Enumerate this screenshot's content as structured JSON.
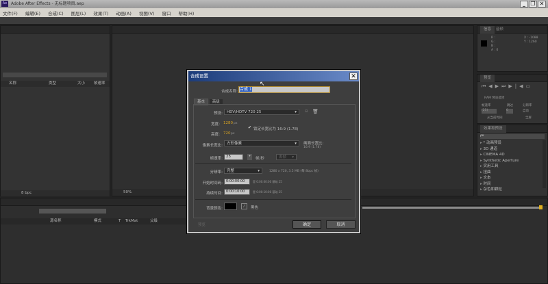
{
  "window": {
    "title": "Adobe After Effects - 无标题项目.aep",
    "app_icon": "Ae",
    "minimize": "_",
    "restore": "❐",
    "close": "✕"
  },
  "menu": [
    "文件(F)",
    "编辑(E)",
    "合成(C)",
    "图层(L)",
    "效果(T)",
    "动画(A)",
    "视图(V)",
    "窗口",
    "帮助(H)"
  ],
  "project_panel": {
    "columns": {
      "name": "名称",
      "type": "类型",
      "size": "大小",
      "fps": "帧速率"
    },
    "bpc": "8 bpc"
  },
  "viewer": {
    "zoom": "50%"
  },
  "info_panel": {
    "tab": "信息",
    "tab2": "音频",
    "r": "R :",
    "g": "G :",
    "b": "B :",
    "a": "A : 0",
    "x": "X : -1088",
    "y": "Y : 1260"
  },
  "preview_panel": {
    "tab": "预览",
    "ram": "RAM 预览选项",
    "fps_label": "帧速率",
    "skip_label": "跳过",
    "res_label": "分辨率",
    "fps_val": "(25)",
    "skip_val": "0",
    "res_val": "自动",
    "from_current": "从当前时间",
    "full_screen": "全屏"
  },
  "effects_panel": {
    "tab": "效果和预设",
    "search": "ρ▾",
    "items": [
      "* 动画预设",
      "3D 通道",
      "CINEMA 4D",
      "Synthetic Aperture",
      "实用工具",
      "扭曲",
      "文本",
      "时间",
      "杂色和颗粒"
    ]
  },
  "timeline": {
    "columns": {
      "source": "源名称",
      "mode": "模式",
      "t": "T",
      "trkmat": "TrkMat",
      "parent": "父级"
    }
  },
  "dialog": {
    "title": "合成设置",
    "name_label": "合成名称:",
    "name_value": "合成 1",
    "tabs": [
      "基本",
      "高级"
    ],
    "preset_label": "预设:",
    "preset_value": "HDV/HDTV 720 25",
    "width_label": "宽度:",
    "width_value": "1280",
    "height_label": "高度:",
    "height_value": "720",
    "px": "px",
    "lock_label": "锁定长宽比为 16:9 (1.78)",
    "lock_checked": true,
    "par_label": "像素长宽比:",
    "par_value": "方形像素",
    "frame_ar_label": "画面长宽比:",
    "frame_ar_value": "16:9 (1.78)",
    "fps_label": "帧速率:",
    "fps_value": "25",
    "fps_unit": "帧/秒",
    "drop_frame": "丢帧",
    "res_label": "分辨率:",
    "res_value": "完整",
    "res_info": "1280 x 720, 3.5 MB (每 8bpc 帧)",
    "start_label": "开始时间码:",
    "start_value": "0:00:00:00",
    "start_info": "是 0:00:00:00  基础 25",
    "dur_label": "持续时间:",
    "dur_value": "0:00:10:00",
    "dur_info": "是 0:00:10:00  基础 25",
    "bg_label": "背景颜色:",
    "bg_color": "#000000",
    "bg_name": "黑色",
    "preview": "预览",
    "ok": "确定",
    "cancel": "取消"
  }
}
